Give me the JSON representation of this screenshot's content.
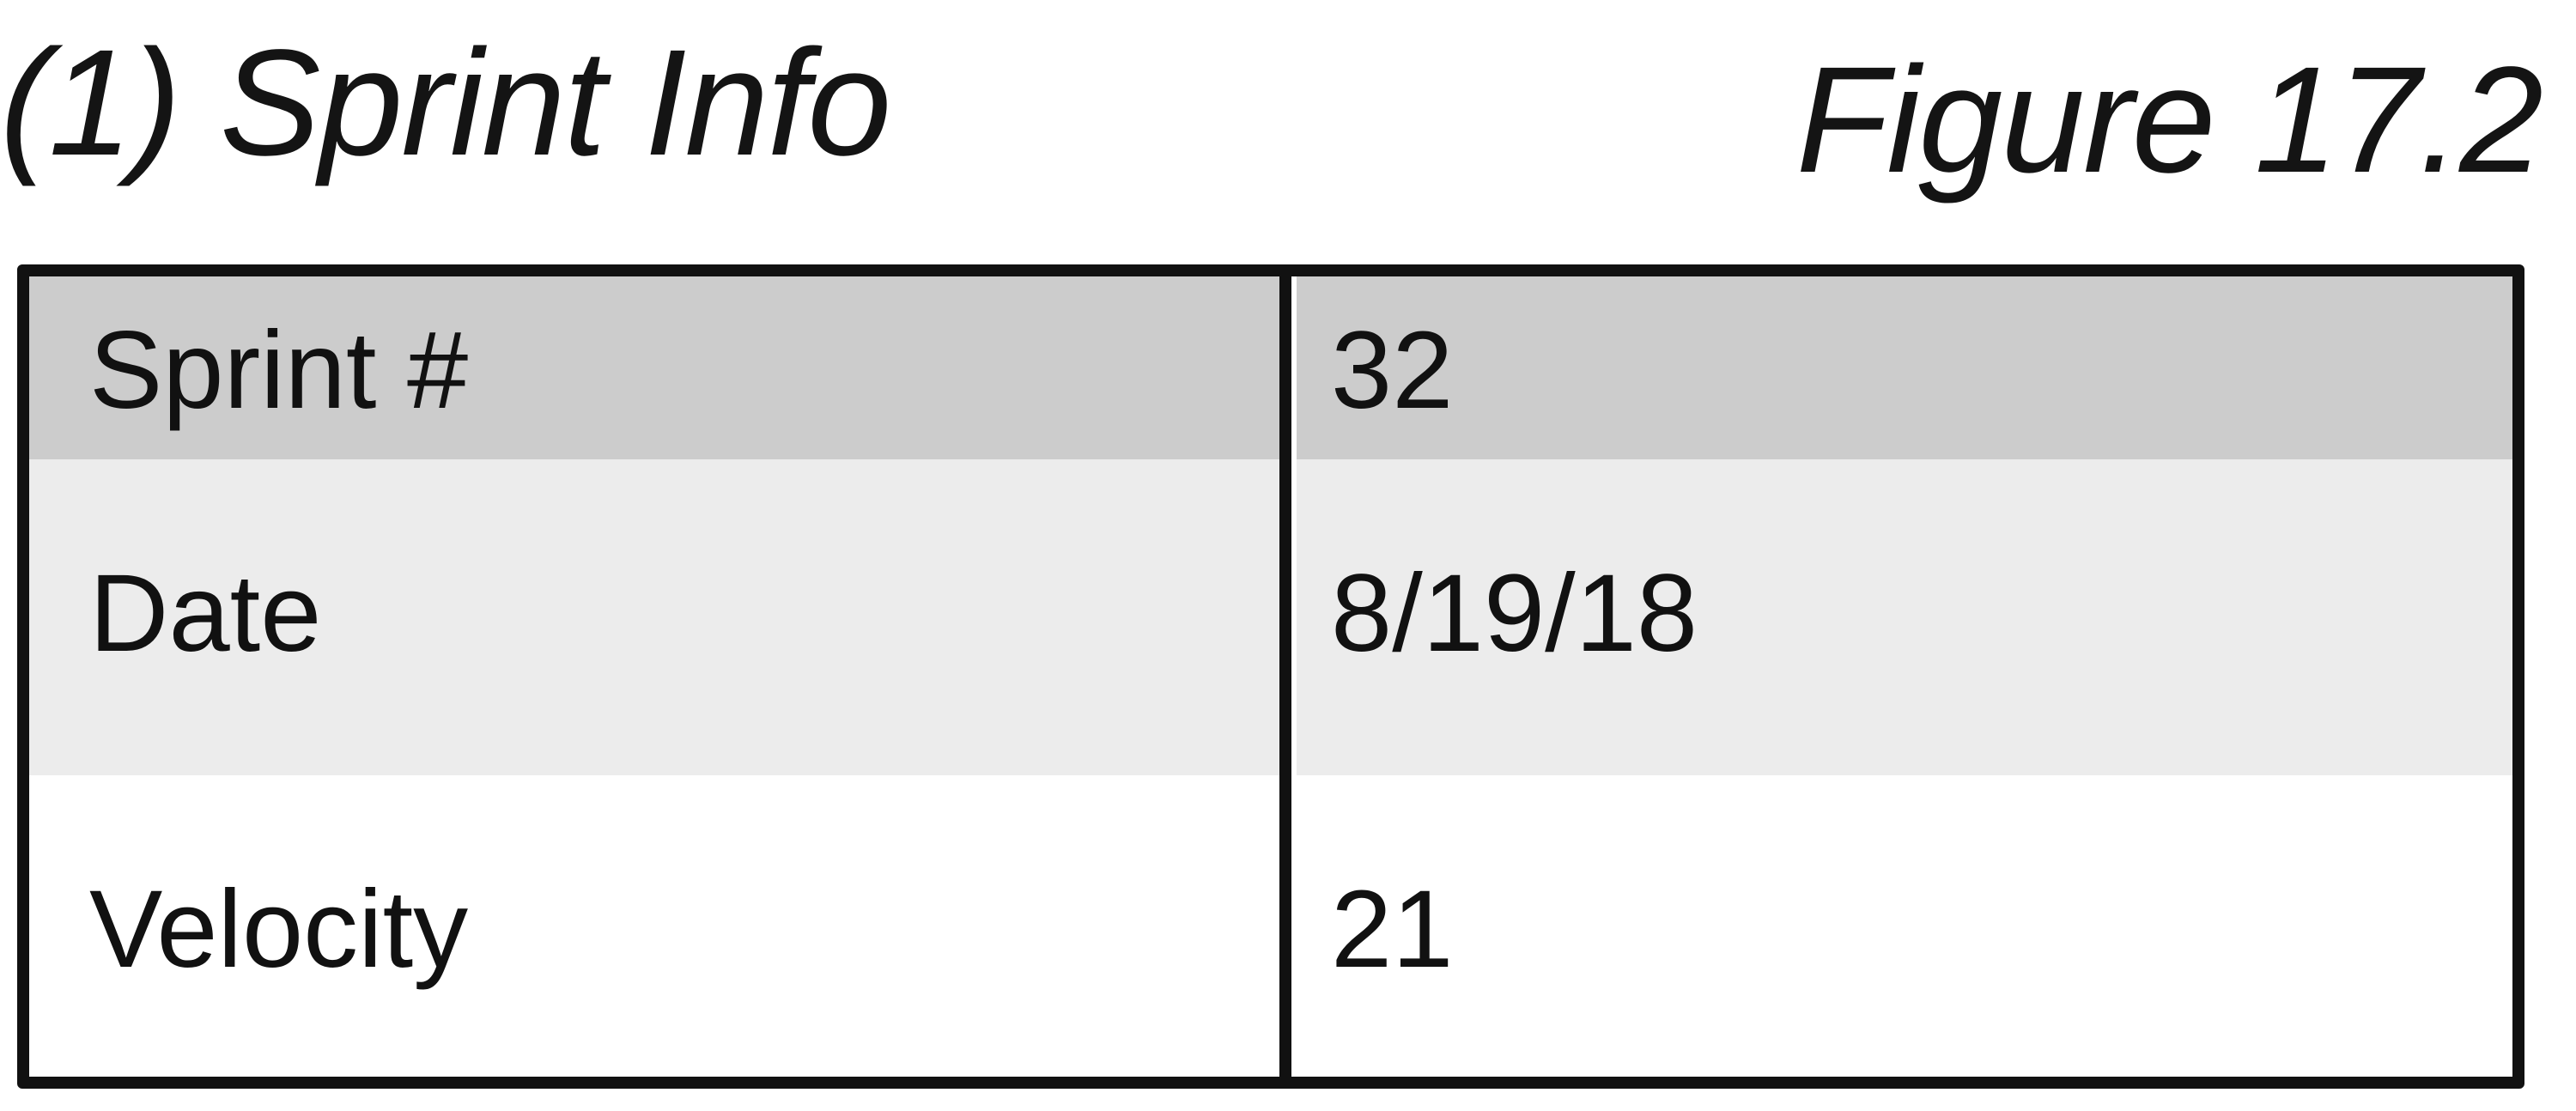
{
  "header": {
    "title": "(1) Sprint Info",
    "figure_label": "Figure 17.2"
  },
  "table": {
    "rows": [
      {
        "label": "Sprint #",
        "value": "32",
        "fill": "#cccccc"
      },
      {
        "label": "Date",
        "value": "8/19/18",
        "fill": "#ececec"
      },
      {
        "label": "Velocity",
        "value": "21",
        "fill": "#ffffff"
      }
    ]
  }
}
